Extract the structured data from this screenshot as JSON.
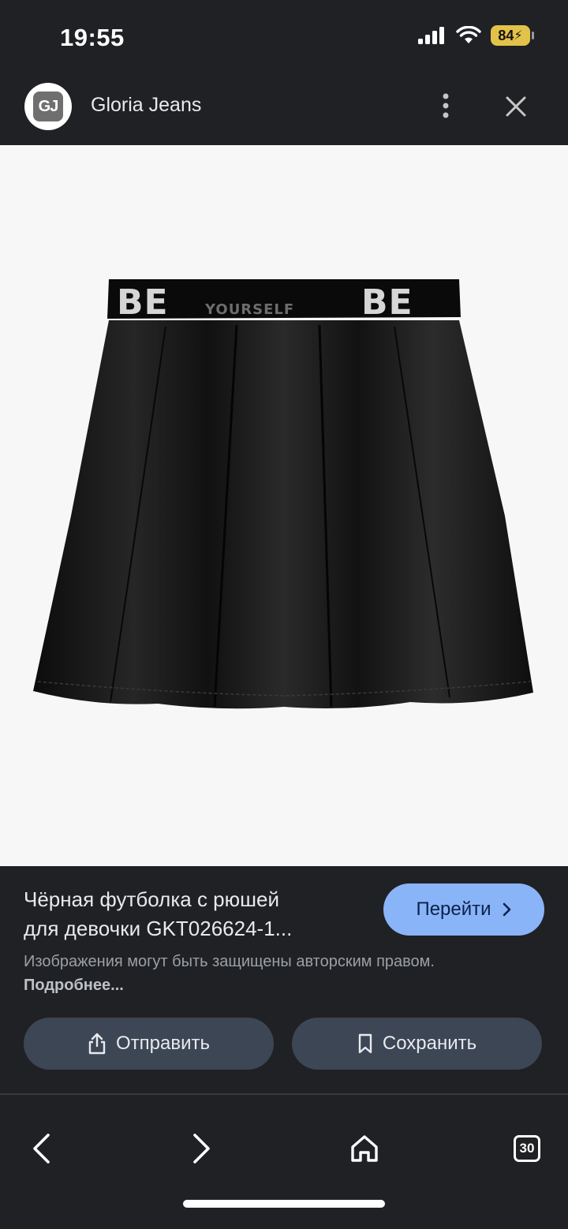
{
  "status": {
    "time": "19:55",
    "battery": "84"
  },
  "header": {
    "logo_text": "GJ",
    "site_name": "Gloria Jeans"
  },
  "image": {
    "waistband_text_left": "BE",
    "waistband_text_middle": "YOURSELF",
    "waistband_text_right": "BE"
  },
  "info": {
    "title_line1": "Чёрная футболка с рюшей",
    "title_line2": "для девочки GKT026624-1...",
    "go_label": "Перейти",
    "disclaimer_text": "Изображения могут быть защищены авторским правом.",
    "disclaimer_link": "Подробнее...",
    "share_label": "Отправить",
    "save_label": "Сохранить"
  },
  "bottom_nav": {
    "tabs_count": "30"
  }
}
